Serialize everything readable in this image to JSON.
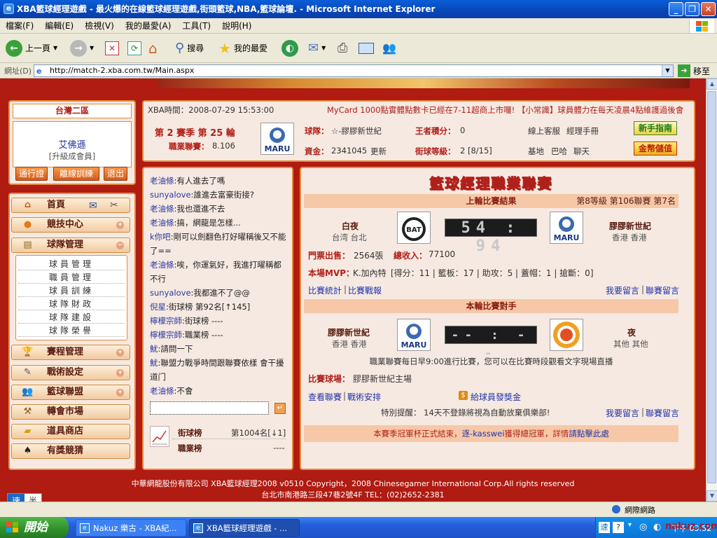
{
  "window": {
    "title": "XBA籃球經理遊戲 - 最火爆的在線籃球經理遊戲,街頭籃球,NBA,籃球論壇. - Microsoft Internet Explorer"
  },
  "menu": [
    "檔案(F)",
    "編輯(E)",
    "檢視(V)",
    "我的最愛(A)",
    "工具(T)",
    "說明(H)"
  ],
  "toolbar": {
    "back": "上一頁",
    "search": "搜尋",
    "favorites": "我的最愛"
  },
  "address": {
    "label": "網址(D)",
    "url": "http://match-2.xba.com.tw/Main.aspx",
    "go": "移至"
  },
  "sidebar": {
    "server": "台灣二區",
    "username": "艾佛遜",
    "member": "[升級成會員]",
    "buttons": [
      "通行證",
      "離線訓練",
      "退出"
    ],
    "nav": [
      {
        "label": "首頁",
        "icon": "home-icon"
      },
      {
        "label": "競技中心",
        "icon": "basketball-icon"
      },
      {
        "label": "球隊管理",
        "icon": "clipboard-icon"
      },
      {
        "label": "賽程管理",
        "icon": "trophy-icon"
      },
      {
        "label": "戰術設定",
        "icon": "tactics-icon"
      },
      {
        "label": "籃球聯盟",
        "icon": "league-icon"
      },
      {
        "label": "轉會市場",
        "icon": "hammer-icon"
      },
      {
        "label": "道具商店",
        "icon": "gold-icon"
      },
      {
        "label": "有獎競猜",
        "icon": "spade-icon"
      }
    ],
    "team_sub": [
      "球員管理",
      "職員管理",
      "球員訓練",
      "球隊財政",
      "球隊建設",
      "球隊榮譽"
    ]
  },
  "info": {
    "time_label": "XBA時間：2008-07-29 15:53:00",
    "ticker": "MyCard 1000點實體點數卡已經在7-11超商上市囉! 【小常識】球員體力在每天凌晨4點維護過後會",
    "season": "第 2 賽季 第 25 輪",
    "league_label": "職業聯賽：",
    "league_val": "8.106",
    "team_label": "球隊：",
    "team_val": "☆-膠膠新世紀",
    "points_label": "王者積分：",
    "points_val": "0",
    "cs": "線上客服",
    "manual": "經理手冊",
    "funds_label": "資金：",
    "funds_val": "2341045",
    "refresh": "更新",
    "level_label": "街球等級：",
    "level_val": "2 [8/15]",
    "base": "基地",
    "bar": "巴哈",
    "chat": "聊天",
    "newbie": "新手指南",
    "deposit": "金幣儲值"
  },
  "chat": [
    {
      "name": "老油條",
      "msg": ":有人進去了嗎"
    },
    {
      "name": "sunyalove",
      "msg": ":誰進去富豪街接?"
    },
    {
      "name": "老油條",
      "msg": ":我也還進不去"
    },
    {
      "name": "老油條",
      "msg": ":搞，網龍是怎樣..."
    },
    {
      "name": "k你吧",
      "msg": ":剛可以劍翻色打好曜稱後又不能了=="
    },
    {
      "name": "老油條",
      "msg": ":唉，你運氣好，我進打曜稱都不行"
    },
    {
      "name": "sunyalove",
      "msg": ":我都進不了@@"
    },
    {
      "name": "倪星",
      "msg": ":街球榜 第92名[↑145]"
    },
    {
      "name": "檸檬宗師",
      "msg": ":街球榜 ----"
    },
    {
      "name": "檸檬宗師",
      "msg": ":職業榜 ----"
    },
    {
      "name": "魷",
      "msg": ":請問一下"
    },
    {
      "name": "魷",
      "msg": ":聯盟力戰爭時間跟聯賽依樣 會干擾道门"
    },
    {
      "name": "老油條",
      "msg": ":不會"
    }
  ],
  "rank": {
    "street_label": "街球榜",
    "street_val": "第1004名[↓1]",
    "pro_label": "職業榜",
    "pro_val": "----"
  },
  "main": {
    "title": "籃球經理職業聯賽",
    "last_header": "上輪比賽結果",
    "level_info": "第8等級 第106聯賽 第7名",
    "home_team": "白夜",
    "home_loc": "台湾 台北",
    "score": "54 : 94",
    "away_team": "膠膠新世紀",
    "away_loc": "香港 香港",
    "tickets_label": "門票出售：",
    "tickets_val": "2564張",
    "income_label": "總收入：",
    "income_val": "77100",
    "mvp_label": "本場MVP：",
    "mvp_val": "K.加內特",
    "mvp_stats": "[得分：11 | 籃板：17 | 助攻：5 | 蓋帽：1 | 搶斷：0]",
    "stats_link": "比賽統計",
    "report_link": "比賽戰報",
    "msg_link": "我要留言",
    "league_msg_link": "聯賽留言",
    "next_header": "本輪比賽對手",
    "next_home": "膠膠新世紀",
    "next_home_loc": "香港 香港",
    "next_score": "-- : --",
    "next_away": "夜",
    "next_away_loc": "其他 其他",
    "notice": "職業聯賽每日早9:00進行比賽，您可以在比賽時段觀看文字現場直播",
    "venue_label": "比賽球場：",
    "venue_val": "膠膠新世紀主場",
    "league_link": "查看聯賽",
    "tactics_link": "戰術安排",
    "bonus": "給球員發獎金",
    "reminder": "特別提醒： 14天不登錄將視為自動放棄俱樂部!",
    "footer_a": "本賽季冠軍杯正式結束，",
    "footer_winner": "逐-kasswei",
    "footer_b": "獲得總冠軍，詳情",
    "footer_link": "請點擊此處"
  },
  "copyright": {
    "line1": "中華網龍股份有限公司 XBA籃球經理2008 v0510    Copyright，2008 Chinesegamer International Corp.All rights reserved",
    "line2": "台北市南港路三段47巷2號4F TEL：(02)2652-2381"
  },
  "badge": [
    "速",
    "半"
  ],
  "status": {
    "zone": "網際網路",
    "watermark": "nakuz.com"
  },
  "taskbar": {
    "start": "開始",
    "tasks": [
      "Nakuz 樂古 - XBA紀...",
      "XBA籃球經理遊戲 - ..."
    ],
    "time": "下午 03:52"
  }
}
